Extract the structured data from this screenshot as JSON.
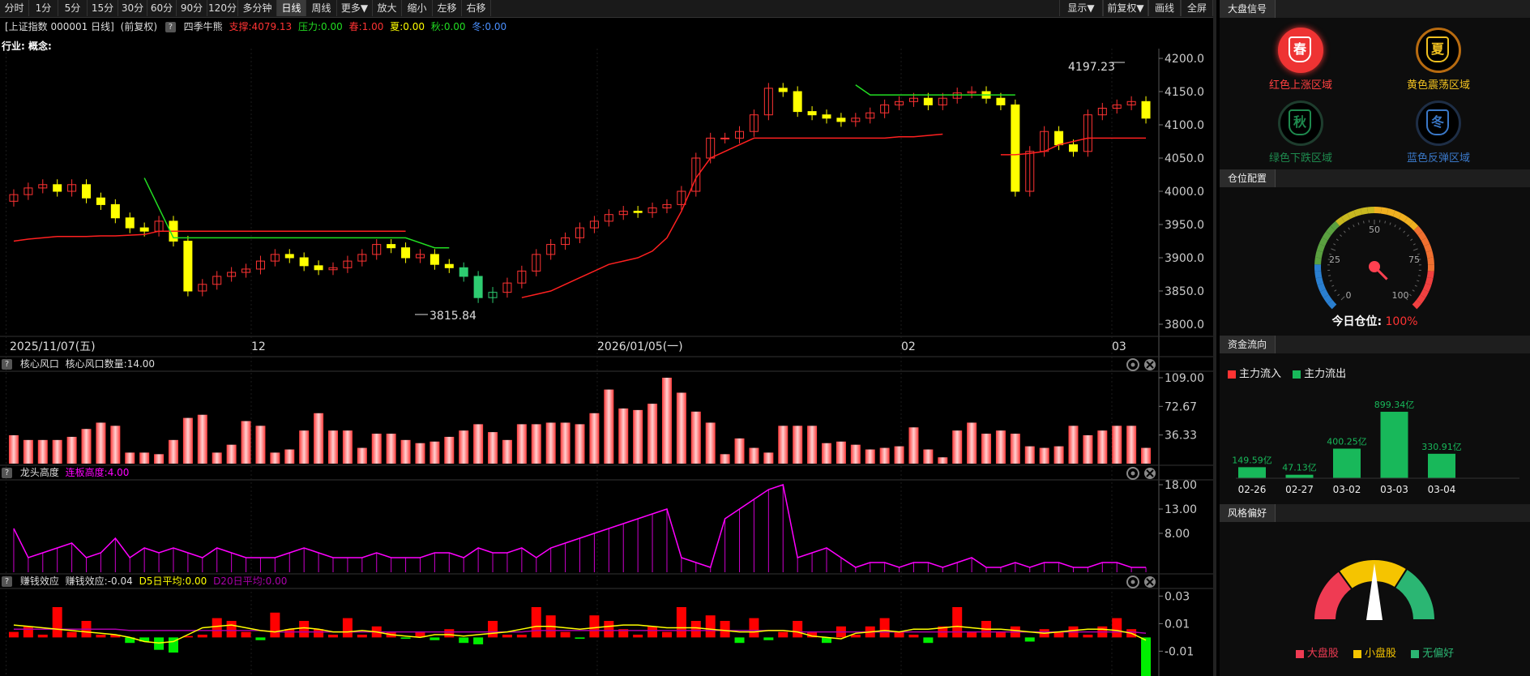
{
  "toolbar": {
    "left_buttons": [
      "分时",
      "1分",
      "5分",
      "15分",
      "30分",
      "60分",
      "90分",
      "120分",
      "多分钟",
      "日线",
      "周线",
      "更多▼",
      "放大",
      "缩小",
      "左移",
      "右移"
    ],
    "active": "日线",
    "right_buttons": [
      "显示▼",
      "前复权▼",
      "画线",
      "全屏"
    ]
  },
  "info": {
    "title": "[上证指数 000001 日线]",
    "adjust": "(前复权)",
    "q": "?",
    "indicator": "四季牛熊",
    "support": "支撑:4079.13",
    "pressure": "压力:0.00",
    "spring": "春:1.00",
    "summer": "夏:0.00",
    "autumn": "秋:0.00",
    "winter": "冬:0.00",
    "industry": "行业: 概念:"
  },
  "main_chart": {
    "price_ticks": [
      "4200.0",
      "4150.0",
      "4100.0",
      "4050.0",
      "4000.0",
      "3950.0",
      "3900.0",
      "3850.0",
      "3800.0"
    ],
    "high_label": "4197.23",
    "low_label": "3815.84",
    "date_labels": [
      "2025/11/07(五)",
      "12",
      "2026/01/05(一)",
      "02",
      "03"
    ],
    "colors": {
      "up": "#ff3333",
      "down_yellow": "#ffff00",
      "down_green": "#2ecc71",
      "support": "#ff2020",
      "pressure": "#22dd22"
    }
  },
  "sub1": {
    "q": "?",
    "name": "核心风口",
    "value_label": "核心风口数量:14.00",
    "ticks": [
      "109.00",
      "72.67",
      "36.33"
    ],
    "values": [
      36,
      30,
      30,
      30,
      34,
      44,
      52,
      48,
      14,
      14,
      12,
      30,
      58,
      62,
      14,
      24,
      54,
      48,
      14,
      18,
      42,
      64,
      42,
      42,
      20,
      38,
      38,
      30,
      26,
      28,
      34,
      42,
      50,
      40,
      30,
      50,
      50,
      52,
      52,
      50,
      64,
      94,
      70,
      68,
      76,
      126,
      90,
      66,
      52,
      12,
      32,
      20,
      14,
      48,
      48,
      48,
      26,
      28,
      24,
      18,
      20,
      22,
      46,
      18,
      8,
      42,
      52,
      38,
      42,
      38,
      22,
      20,
      22,
      48,
      36,
      42,
      48,
      48,
      20
    ]
  },
  "sub2": {
    "q": "?",
    "name": "龙头高度",
    "value_label": "连板高度:4.00",
    "ticks": [
      "18.00",
      "13.00",
      "8.00"
    ],
    "values": [
      9,
      3,
      4,
      5,
      6,
      3,
      4,
      7,
      3,
      5,
      4,
      5,
      4,
      3,
      5,
      4,
      3,
      3,
      3,
      4,
      5,
      4,
      3,
      3,
      3,
      4,
      3,
      3,
      3,
      4,
      4,
      3,
      5,
      4,
      4,
      5,
      3,
      5,
      6,
      7,
      8,
      9,
      10,
      11,
      12,
      13,
      3,
      2,
      1,
      11,
      13,
      15,
      17,
      18,
      3,
      4,
      5,
      3,
      1,
      2,
      2,
      1,
      2,
      2,
      1,
      2,
      3,
      1,
      1,
      2,
      1,
      2,
      2,
      1,
      1,
      2,
      2,
      1,
      1
    ]
  },
  "sub3": {
    "q": "?",
    "name": "赚钱效应",
    "value_label": "赚钱效应:-0.04",
    "d5": "D5日平均:0.00",
    "d20": "D20日平均:0.00",
    "ticks": [
      "0.03",
      "0.01",
      "-0.01"
    ],
    "values": [
      0.004,
      0.008,
      0.002,
      0.022,
      0.004,
      0.012,
      0.002,
      0.002,
      -0.004,
      -0.003,
      -0.009,
      -0.011,
      0.001,
      0.002,
      0.014,
      0.012,
      0.004,
      -0.002,
      0.018,
      0.006,
      0.012,
      0.006,
      0.002,
      0.014,
      0.002,
      0.008,
      0.004,
      -0.001,
      0.004,
      -0.002,
      0.006,
      -0.004,
      -0.005,
      0.012,
      0.002,
      0.002,
      0.022,
      0.016,
      0.004,
      -0.001,
      0.016,
      0.012,
      0.006,
      0.002,
      0.008,
      0.004,
      0.022,
      0.012,
      0.016,
      0.012,
      -0.004,
      0.014,
      -0.002,
      0.004,
      0.012,
      0.004,
      -0.004,
      0.008,
      0.002,
      0.008,
      0.014,
      0.004,
      0.002,
      -0.004,
      0.008,
      0.022,
      0.004,
      0.012,
      0.004,
      0.008,
      -0.003,
      0.006,
      0.004,
      0.008,
      0.002,
      0.008,
      0.014,
      0.006,
      -0.028
    ],
    "d5_values": [
      0.009,
      0.008,
      0.007,
      0.006,
      0.005,
      0.004,
      0.003,
      0.002,
      0.0,
      -0.003,
      -0.004,
      -0.003,
      0.002,
      0.007,
      0.008,
      0.009,
      0.007,
      0.005,
      0.004,
      0.006,
      0.007,
      0.006,
      0.004,
      0.004,
      0.005,
      0.004,
      0.002,
      0.001,
      0.0,
      0.002,
      0.002,
      0.001,
      0.002,
      0.003,
      0.004,
      0.006,
      0.008,
      0.008,
      0.007,
      0.006,
      0.007,
      0.008,
      0.009,
      0.009,
      0.008,
      0.007,
      0.007,
      0.007,
      0.006,
      0.005,
      0.004,
      0.004,
      0.005,
      0.005,
      0.004,
      0.001,
      0.0,
      -0.001,
      0.003,
      0.004,
      0.005,
      0.004,
      0.006,
      0.006,
      0.007,
      0.008,
      0.007,
      0.006,
      0.006,
      0.005,
      0.004,
      0.003,
      0.004,
      0.005,
      0.006,
      0.006,
      0.005,
      0.003,
      -0.002
    ],
    "d20_values": [
      0.006,
      0.006,
      0.006,
      0.006,
      0.006,
      0.006,
      0.006,
      0.006,
      0.005,
      0.005,
      0.005,
      0.005,
      0.005,
      0.005,
      0.005,
      0.005,
      0.005,
      0.005,
      0.004,
      0.004,
      0.004,
      0.004,
      0.004,
      0.004,
      0.004,
      0.004,
      0.004,
      0.004,
      0.004,
      0.004,
      0.004,
      0.004,
      0.004,
      0.004,
      0.004,
      0.004,
      0.005,
      0.005,
      0.005,
      0.005,
      0.005,
      0.005,
      0.005,
      0.005,
      0.005,
      0.005,
      0.005,
      0.005,
      0.005,
      0.005,
      0.005,
      0.005,
      0.005,
      0.005,
      0.004,
      0.004,
      0.004,
      0.004,
      0.004,
      0.004,
      0.004,
      0.004,
      0.004,
      0.004,
      0.004,
      0.004,
      0.004,
      0.004,
      0.004,
      0.004,
      0.004,
      0.004,
      0.004,
      0.004,
      0.004,
      0.004,
      0.004,
      0.004,
      0.003
    ]
  },
  "right": {
    "signal_tab": "大盘信号",
    "seasons": [
      {
        "char": "春",
        "label": "红色上涨区域",
        "color": "#e33",
        "textcolor": "#ff4040",
        "active": true
      },
      {
        "char": "夏",
        "label": "黄色震荡区域",
        "color": "#b86b10",
        "textcolor": "#f0c020",
        "active": false
      },
      {
        "char": "秋",
        "label": "绿色下跌区域",
        "color": "#1e3d2e",
        "textcolor": "#1e8a4e",
        "active": false
      },
      {
        "char": "冬",
        "label": "蓝色反弹区域",
        "color": "#1e2e46",
        "textcolor": "#3a78c8",
        "active": false
      }
    ],
    "position_tab": "仓位配置",
    "gauge_labels": [
      "0",
      "25",
      "50",
      "75",
      "100"
    ],
    "position_label": "今日仓位:",
    "position_value": "100%",
    "position_fraction": 1.0,
    "fund_tab": "资金流向",
    "legend_in": "主力流入",
    "legend_out": "主力流出",
    "fund_bars": [
      {
        "date": "02-26",
        "value": 149.59,
        "label": "149.59亿"
      },
      {
        "date": "02-27",
        "value": 47.13,
        "label": "47.13亿"
      },
      {
        "date": "03-02",
        "value": 400.25,
        "label": "400.25亿"
      },
      {
        "date": "03-03",
        "value": 899.34,
        "label": "899.34亿"
      },
      {
        "date": "03-04",
        "value": 330.91,
        "label": "330.91亿"
      }
    ],
    "style_tab": "风格偏好",
    "style_legend": [
      "大盘股",
      "小盘股",
      "无偏好"
    ],
    "style_colors": [
      "#ef3b53",
      "#f5c400",
      "#2bb673"
    ]
  }
}
